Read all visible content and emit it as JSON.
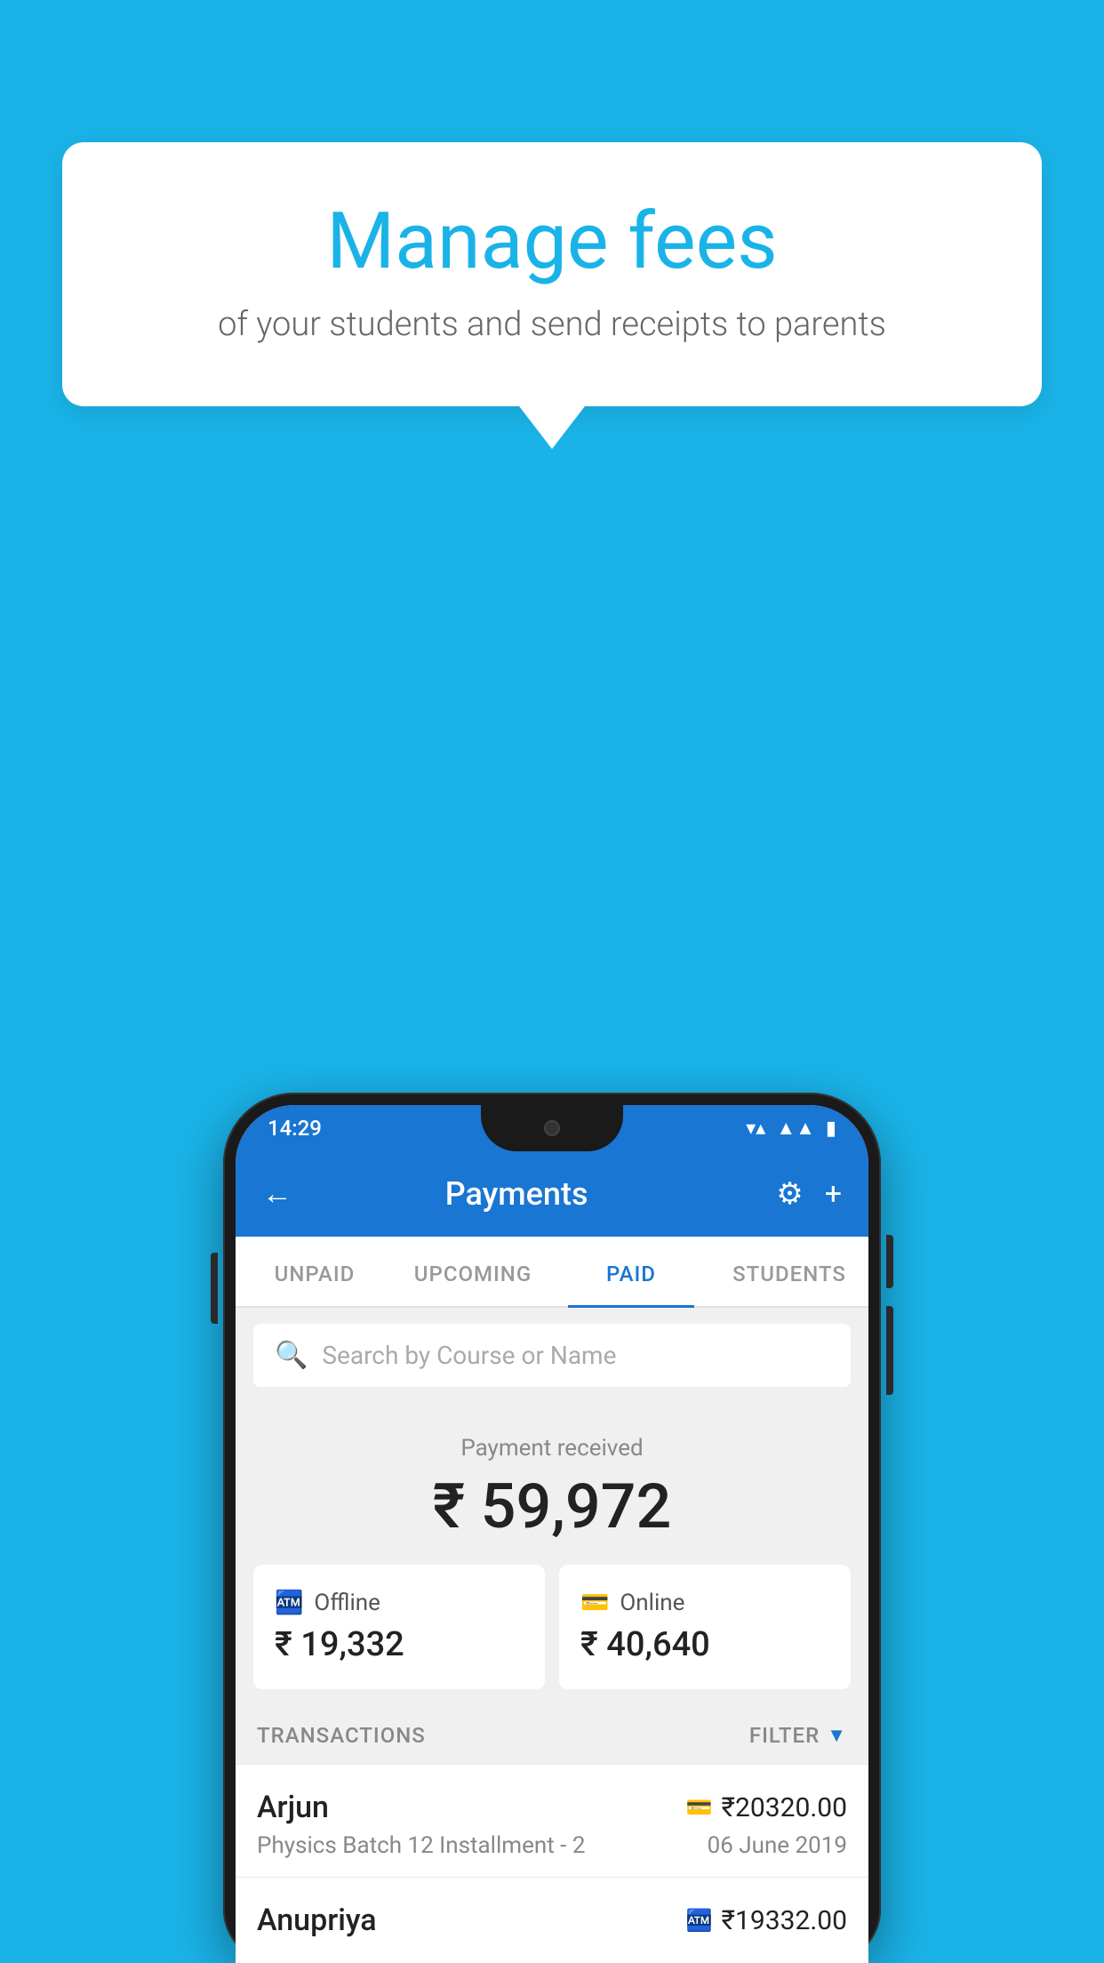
{
  "background_color": "#1ab3e8",
  "hero": {
    "title": "Manage fees",
    "subtitle": "of your students and send receipts to parents"
  },
  "phone": {
    "status_bar": {
      "time": "14:29",
      "wifi_icon": "▲",
      "signal_icon": "▲",
      "battery_icon": "▮"
    },
    "app_bar": {
      "back_icon": "←",
      "title": "Payments",
      "settings_icon": "⚙",
      "add_icon": "+"
    },
    "tabs": [
      {
        "label": "UNPAID",
        "active": false
      },
      {
        "label": "UPCOMING",
        "active": false
      },
      {
        "label": "PAID",
        "active": true
      },
      {
        "label": "STUDENTS",
        "active": false
      }
    ],
    "search": {
      "placeholder": "Search by Course or Name"
    },
    "payment_summary": {
      "label": "Payment received",
      "amount": "₹ 59,972",
      "offline": {
        "type": "Offline",
        "amount": "₹ 19,332"
      },
      "online": {
        "type": "Online",
        "amount": "₹ 40,640"
      }
    },
    "transactions": {
      "header": "TRANSACTIONS",
      "filter_label": "FILTER",
      "items": [
        {
          "name": "Arjun",
          "amount": "₹20320.00",
          "course": "Physics Batch 12 Installment - 2",
          "date": "06 June 2019",
          "payment_type": "online"
        },
        {
          "name": "Anupriya",
          "amount": "₹19332.00",
          "course": "",
          "date": "",
          "payment_type": "offline"
        }
      ]
    }
  }
}
